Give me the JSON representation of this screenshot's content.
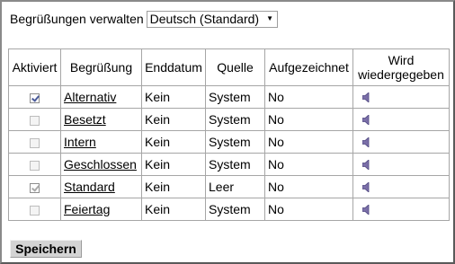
{
  "header": {
    "label": "Begrüßungen verwalten",
    "language_select": {
      "value": "Deutsch (Standard)"
    }
  },
  "table": {
    "columns": [
      "Aktiviert",
      "Begrüßung",
      "Enddatum",
      "Quelle",
      "Aufgezeichnet",
      "Wird wiedergegeben"
    ],
    "rows": [
      {
        "enabled": true,
        "disabled": false,
        "name": "Alternativ",
        "end_date": "Kein",
        "source": "System",
        "recorded": "No",
        "play_icon": "speaker-icon"
      },
      {
        "enabled": false,
        "disabled": false,
        "name": "Besetzt",
        "end_date": "Kein",
        "source": "System",
        "recorded": "No",
        "play_icon": "speaker-icon"
      },
      {
        "enabled": false,
        "disabled": false,
        "name": "Intern",
        "end_date": "Kein",
        "source": "System",
        "recorded": "No",
        "play_icon": "speaker-icon"
      },
      {
        "enabled": false,
        "disabled": false,
        "name": "Geschlossen",
        "end_date": "Kein",
        "source": "System",
        "recorded": "No",
        "play_icon": "speaker-icon"
      },
      {
        "enabled": true,
        "disabled": true,
        "name": "Standard",
        "end_date": "Kein",
        "source": "Leer",
        "recorded": "No",
        "play_icon": "speaker-icon"
      },
      {
        "enabled": false,
        "disabled": false,
        "name": "Feiertag",
        "end_date": "Kein",
        "source": "System",
        "recorded": "No",
        "play_icon": "speaker-icon"
      }
    ]
  },
  "footer": {
    "save_label": "Speichern"
  },
  "colors": {
    "border": "#a6a6a6",
    "button_bg": "#d4d4d4",
    "speaker": "#7b6fa8"
  }
}
